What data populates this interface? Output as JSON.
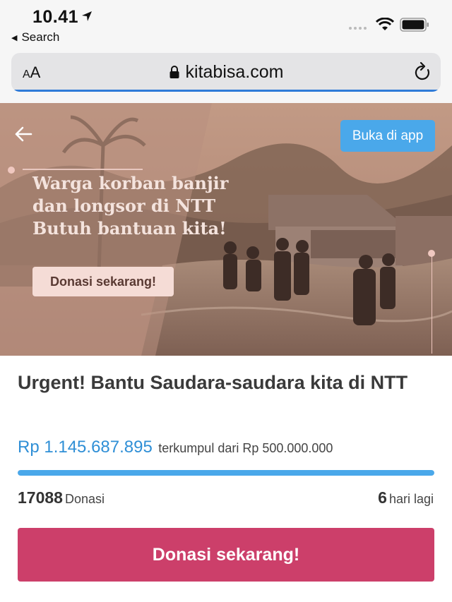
{
  "status_bar": {
    "time": "10.41",
    "back_label": "Search"
  },
  "browser": {
    "text_size_label_small": "A",
    "text_size_label_large": "A",
    "url": "kitabisa.com"
  },
  "hero": {
    "open_app_label": "Buka di app",
    "title_lines": [
      "Warga korban banjir",
      "dan longsor di NTT",
      "Butuh bantuan kita!"
    ],
    "cta_label": "Donasi sekarang!"
  },
  "campaign": {
    "title": "Urgent! Bantu Saudara-saudara kita di NTT",
    "amount_collected": "Rp 1.145.687.895",
    "target_text": "terkumpul dari Rp 500.000.000",
    "progress_fraction": 1.0,
    "donation_count": "17088",
    "donation_label": "Donasi",
    "days_left": "6",
    "days_label": "hari lagi",
    "donate_button_label": "Donasi sekarang!"
  },
  "colors": {
    "accent_blue": "#2f8fd6",
    "progress_blue": "#4aa8ea",
    "donate_pink": "#cc3f6a"
  },
  "icons": {
    "status": [
      "location-arrow-icon",
      "cellular-signal-icon",
      "wifi-icon",
      "battery-icon"
    ],
    "browser": [
      "lock-icon",
      "reload-icon"
    ],
    "hero": [
      "back-arrow-icon"
    ]
  }
}
